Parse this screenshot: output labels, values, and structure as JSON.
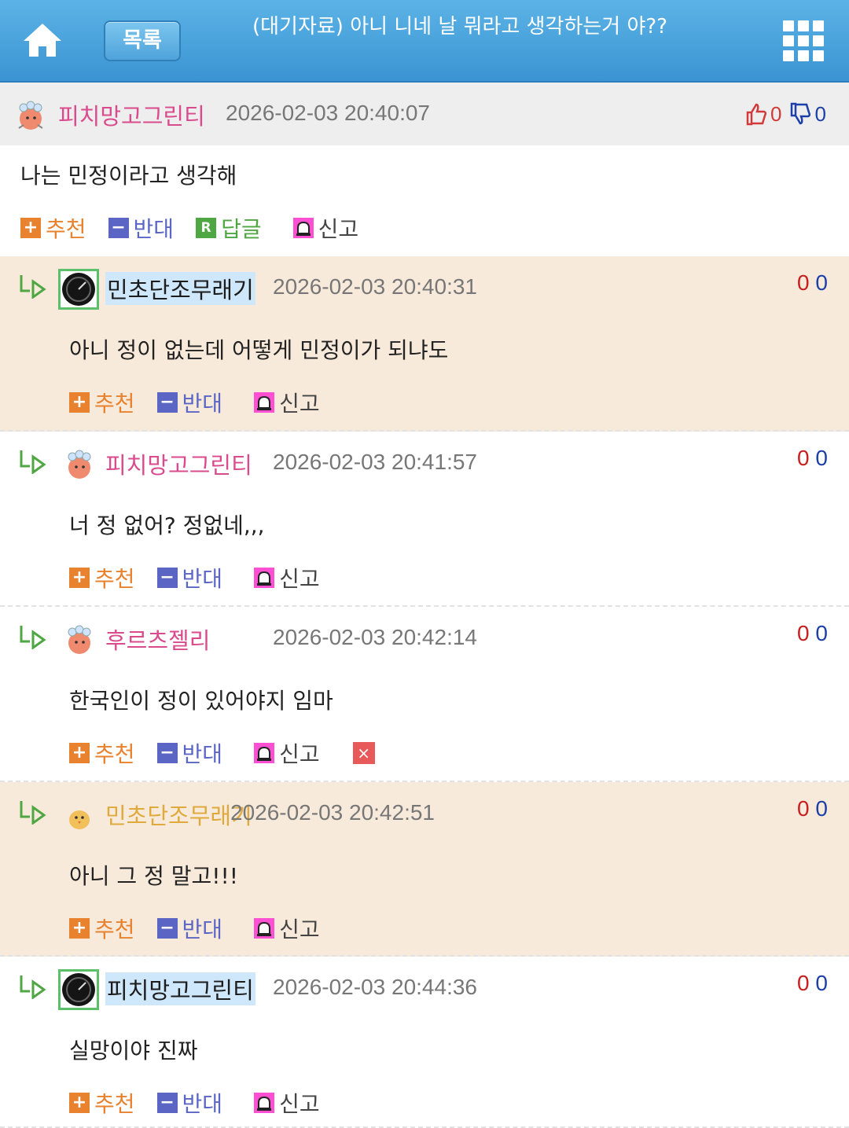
{
  "header": {
    "list_label": "목록",
    "title": "(대기자료) 아니 니네 날 뭐라고 생각하는거 야??"
  },
  "post": {
    "author": "피치망고그린티",
    "date": "2026-02-03 20:40:07",
    "up_count": "0",
    "down_count": "0",
    "body": "나는 민정이라고 생각해",
    "actions": {
      "recommend": "추천",
      "oppose": "반대",
      "reply": "답글",
      "report": "신고"
    }
  },
  "comments": [
    {
      "author": "민초단조무래기",
      "date": "2026-02-03 20:40:31",
      "up": "0",
      "down": "0",
      "body": "아니 정이 없는데 어떻게 민정이가 되냐도"
    },
    {
      "author": "피치망고그린티",
      "date": "2026-02-03 20:41:57",
      "up": "0",
      "down": "0",
      "body": "너 정 없어? 정없네,,,"
    },
    {
      "author": "후르츠젤리",
      "date": "2026-02-03 20:42:14",
      "up": "0",
      "down": "0",
      "body": "한국인이 정이 있어야지 임마"
    },
    {
      "author": "민초단조무래기",
      "date": "2026-02-03 20:42:51",
      "up": "0",
      "down": "0",
      "body": "아니 그 정 말고!!!"
    },
    {
      "author": "피치망고그린티",
      "date": "2026-02-03 20:44:36",
      "up": "0",
      "down": "0",
      "body": "실망이야 진짜"
    }
  ],
  "comment_actions": {
    "recommend": "추천",
    "oppose": "반대",
    "report": "신고",
    "delete": "×"
  },
  "icons": {
    "home": "home-icon",
    "grid": "grid-menu-icon",
    "thumb_up": "thumbs-up-icon",
    "thumb_down": "thumbs-down-icon",
    "reply_arrow": "reply-arrow-icon",
    "plus": "plus-icon",
    "minus": "minus-icon",
    "reply": "reply-r-icon",
    "report": "siren-icon"
  },
  "colors": {
    "header_blue": "#3b94d2",
    "nick_pink": "#d94b8c",
    "nick_yellow": "#e0a93c",
    "highlight_bg": "#f8eadb",
    "recommend": "#e8822e",
    "oppose": "#5b66c4",
    "reply": "#4fa743",
    "report": "#ff4fd2"
  }
}
